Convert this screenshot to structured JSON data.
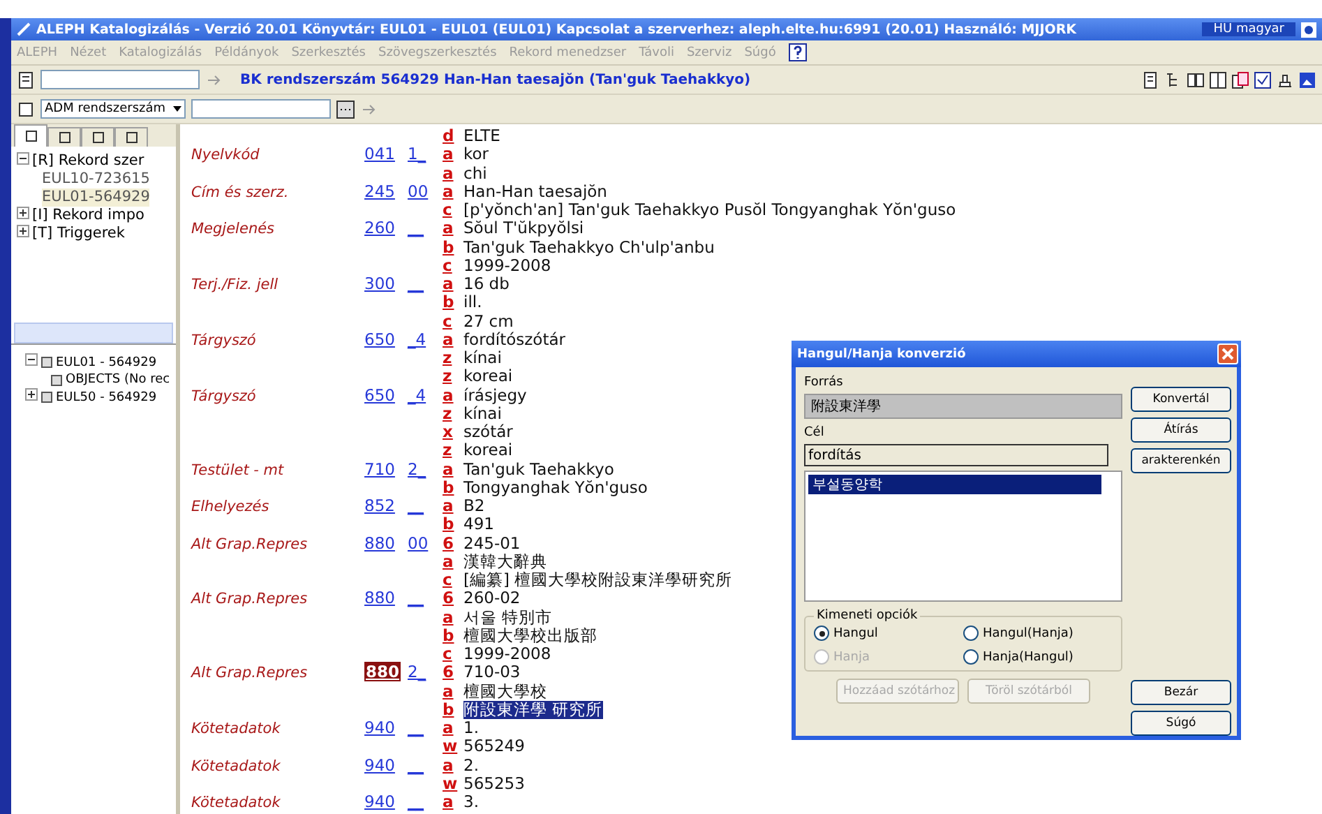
{
  "window": {
    "title": "ALEPH Katalogizálás - Verzió 20.01 Könyvtár: EUL01 - EUL01 (EUL01) Kapcsolat a szerverhez: aleph.elte.hu:6991 (20.01) Használó: MJJORK",
    "language": "HU magyar"
  },
  "menu": [
    "ALEPH",
    "Nézet",
    "Katalogizálás",
    "Példányok",
    "Szerkesztés",
    "Szövegszerkesztés",
    "Rekord menedzser",
    "Távoli",
    "Szerviz",
    "Súgó"
  ],
  "toolbar": {
    "record_title": "BK rendszerszám 564929 Han-Han taesajŏn (Tan'guk Taehakkyo)"
  },
  "search_bar": {
    "select": "ADM rendszerszám"
  },
  "left_panel": {
    "tabs": [
      {
        "selected": true
      },
      {
        "selected": false
      },
      {
        "selected": false
      },
      {
        "selected": false
      }
    ],
    "tree": [
      {
        "label": "[R] Rekord szer",
        "expanded": true,
        "children": [
          {
            "label": "EUL10-723615",
            "selected": false
          },
          {
            "label": "EUL01-564929",
            "selected": true
          }
        ]
      },
      {
        "label": "[I] Rekord impo",
        "expanded": false
      },
      {
        "label": "[T] Triggerek",
        "expanded": false
      }
    ],
    "object_tree": [
      {
        "label": "EUL01 - 564929",
        "expanded": true,
        "children": [
          {
            "label": "OBJECTS (No rec"
          }
        ]
      },
      {
        "label": "EUL50 - 564929",
        "expanded": false
      }
    ]
  },
  "record": {
    "fields": [
      {
        "subfields": [
          {
            "code": "d",
            "value": "ELTE",
            "selected": false
          }
        ]
      },
      {
        "label": "Nyelvkód",
        "tag": "041",
        "tag_selected": false,
        "indicator": "1_",
        "subfields": [
          {
            "code": "a",
            "value": "kor",
            "selected": false
          },
          {
            "code": "a",
            "value": "chi",
            "selected": false
          }
        ]
      },
      {
        "label": "Cím és szerz.",
        "tag": "245",
        "tag_selected": false,
        "indicator": "00",
        "subfields": [
          {
            "code": "a",
            "value": "Han-Han taesajŏn",
            "selected": false
          },
          {
            "code": "c",
            "value": "[p'yŏnch'an] Tan'guk Taehakkyo Pusŏl Tongyanghak Yŏn'guso",
            "selected": false
          }
        ]
      },
      {
        "label": "Megjelenés",
        "tag": "260",
        "tag_selected": false,
        "indicator": "__",
        "subfields": [
          {
            "code": "a",
            "value": "Sŏul T'ŭkpyŏlsi",
            "selected": false
          },
          {
            "code": "b",
            "value": "Tan'guk Taehakkyo Ch'ulp'anbu",
            "selected": false
          },
          {
            "code": "c",
            "value": "1999-2008",
            "selected": false
          }
        ]
      },
      {
        "label": "Terj./Fiz. jell",
        "tag": "300",
        "tag_selected": false,
        "indicator": "__",
        "subfields": [
          {
            "code": "a",
            "value": "16 db",
            "selected": false
          },
          {
            "code": "b",
            "value": "ill.",
            "selected": false
          },
          {
            "code": "c",
            "value": "27 cm",
            "selected": false
          }
        ]
      },
      {
        "label": "Tárgyszó",
        "tag": "650",
        "tag_selected": false,
        "indicator": "_4",
        "subfields": [
          {
            "code": "a",
            "value": "fordítószótár",
            "selected": false
          },
          {
            "code": "z",
            "value": "kínai",
            "selected": false
          },
          {
            "code": "z",
            "value": "koreai",
            "selected": false
          }
        ]
      },
      {
        "label": "Tárgyszó",
        "tag": "650",
        "tag_selected": false,
        "indicator": "_4",
        "subfields": [
          {
            "code": "a",
            "value": "írásjegy",
            "selected": false
          },
          {
            "code": "z",
            "value": "kínai",
            "selected": false
          },
          {
            "code": "x",
            "value": "szótár",
            "selected": false
          },
          {
            "code": "z",
            "value": "koreai",
            "selected": false
          }
        ]
      },
      {
        "label": "Testület - mt",
        "tag": "710",
        "tag_selected": false,
        "indicator": "2_",
        "subfields": [
          {
            "code": "a",
            "value": "Tan'guk Taehakkyo",
            "selected": false
          },
          {
            "code": "b",
            "value": "Tongyanghak Yŏn'guso",
            "selected": false
          }
        ]
      },
      {
        "label": "Elhelyezés",
        "tag": "852",
        "tag_selected": false,
        "indicator": "__",
        "subfields": [
          {
            "code": "a",
            "value": "B2",
            "selected": false
          },
          {
            "code": "b",
            "value": "491",
            "selected": false
          }
        ]
      },
      {
        "label": "Alt Grap.Repres",
        "tag": "880",
        "tag_selected": false,
        "indicator": "00",
        "subfields": [
          {
            "code": "6",
            "value": "245-01",
            "selected": false
          },
          {
            "code": "a",
            "value": "漢韓大辭典",
            "selected": false
          },
          {
            "code": "c",
            "value": "[編纂] 檀國大學校附設東洋學研究所",
            "selected": false
          }
        ]
      },
      {
        "label": "Alt Grap.Repres",
        "tag": "880",
        "tag_selected": false,
        "indicator": "__",
        "subfields": [
          {
            "code": "6",
            "value": "260-02",
            "selected": false
          },
          {
            "code": "a",
            "value": "서울 特別市",
            "selected": false
          },
          {
            "code": "b",
            "value": "檀國大學校出版部",
            "selected": false
          },
          {
            "code": "c",
            "value": "1999-2008",
            "selected": false
          }
        ]
      },
      {
        "label": "Alt Grap.Repres",
        "tag": "880",
        "tag_selected": true,
        "indicator": "2_",
        "subfields": [
          {
            "code": "6",
            "value": "710-03",
            "selected": false
          },
          {
            "code": "a",
            "value": "檀國大學校",
            "selected": false
          },
          {
            "code": "b",
            "value": "附設東洋學 研究所",
            "selected": true
          }
        ]
      },
      {
        "label": "Kötetadatok",
        "tag": "940",
        "tag_selected": false,
        "indicator": "__",
        "subfields": [
          {
            "code": "a",
            "value": "1.",
            "selected": false
          },
          {
            "code": "w",
            "value": "565249",
            "selected": false
          }
        ]
      },
      {
        "label": "Kötetadatok",
        "tag": "940",
        "tag_selected": false,
        "indicator": "__",
        "subfields": [
          {
            "code": "a",
            "value": "2.",
            "selected": false
          },
          {
            "code": "w",
            "value": "565253",
            "selected": false
          }
        ]
      },
      {
        "label": "Kötetadatok",
        "tag": "940",
        "tag_selected": false,
        "indicator": "__",
        "subfields": [
          {
            "code": "a",
            "value": "3.",
            "selected": false
          }
        ]
      }
    ]
  },
  "dialog": {
    "title": "Hangul/Hanja konverzió",
    "source_label": "Forrás",
    "source_value": "附設東洋學",
    "target_label": "Cél",
    "target_value": "fordítás",
    "results": [
      {
        "label": "부설동양학",
        "selected": true
      }
    ],
    "options_label": "Kimeneti opciók",
    "options": [
      {
        "label": "Hangul",
        "selected": true,
        "disabled": false
      },
      {
        "label": "Hangul(Hanja)",
        "selected": false,
        "disabled": false
      },
      {
        "label": "Hanja",
        "selected": false,
        "disabled": true
      },
      {
        "label": "Hanja(Hangul)",
        "selected": false,
        "disabled": false
      }
    ],
    "side_buttons": [
      {
        "label": "Konvertál",
        "disabled": false
      },
      {
        "label": "Átírás",
        "disabled": false
      },
      {
        "label": "arakterenkén",
        "disabled": false
      }
    ],
    "bottom_buttons": [
      {
        "label": "Hozzáad szótárhoz",
        "disabled": true
      },
      {
        "label": "Töröl szótárból",
        "disabled": true
      }
    ],
    "close_buttons": [
      {
        "label": "Bezár",
        "disabled": false
      },
      {
        "label": "Súgó",
        "disabled": false
      }
    ]
  }
}
